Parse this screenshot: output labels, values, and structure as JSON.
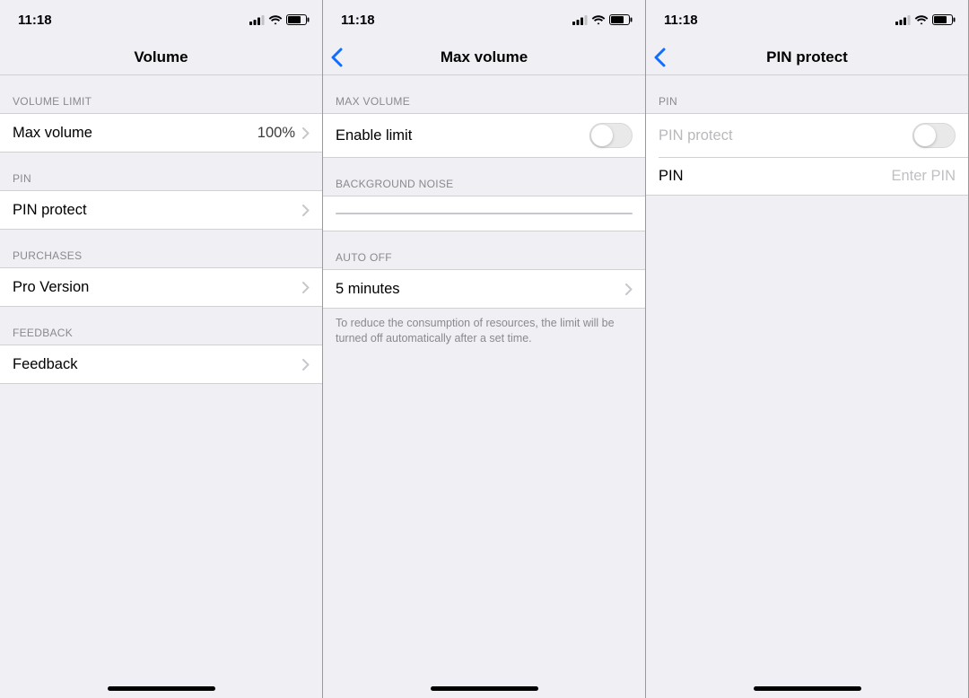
{
  "status": {
    "time": "11:18"
  },
  "screens": {
    "volume": {
      "title": "Volume",
      "sections": {
        "volume_limit": {
          "header": "VOLUME LIMIT",
          "max_volume": {
            "label": "Max volume",
            "value": "100%"
          }
        },
        "pin": {
          "header": "PIN",
          "pin_protect": {
            "label": "PIN protect"
          }
        },
        "purchases": {
          "header": "PURCHASES",
          "pro_version": {
            "label": "Pro Version"
          }
        },
        "feedback": {
          "header": "FEEDBACK",
          "feedback": {
            "label": "Feedback"
          }
        }
      }
    },
    "max_volume": {
      "title": "Max volume",
      "sections": {
        "max_volume": {
          "header": "MAX VOLUME",
          "enable_limit": {
            "label": "Enable limit",
            "on": false
          }
        },
        "background_noise": {
          "header": "BACKGROUND NOISE"
        },
        "auto_off": {
          "header": "AUTO OFF",
          "duration": {
            "label": "5 minutes"
          },
          "footer": "To reduce the consumption of resources, the limit will be turned off automatically after a set time."
        }
      }
    },
    "pin_protect": {
      "title": "PIN protect",
      "sections": {
        "pin": {
          "header": "PIN",
          "toggle": {
            "label": "PIN protect",
            "on": false
          },
          "pin_row": {
            "label": "PIN",
            "placeholder": "Enter PIN"
          }
        }
      }
    }
  }
}
